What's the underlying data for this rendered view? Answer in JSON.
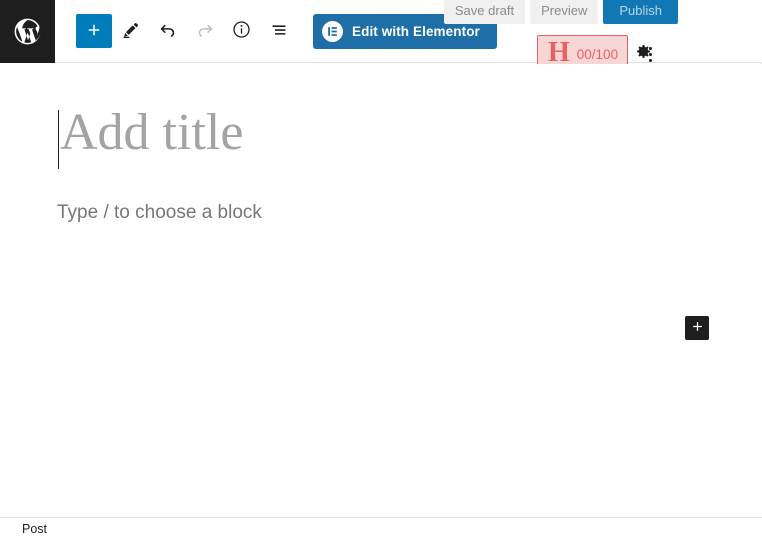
{
  "app": {
    "name": "WordPress Block Editor",
    "logo_icon": "wordpress-logo-icon"
  },
  "toolbar": {
    "add_block": {
      "label": "+",
      "icon": "plus-icon",
      "title": "Toggle block inserter",
      "color": "#007cba"
    },
    "tools": [
      {
        "name": "edit-mode-icon",
        "icon": "pencil-icon",
        "title": "Tools",
        "disabled": false
      },
      {
        "name": "undo-icon",
        "icon": "undo-arrow-icon",
        "title": "Undo",
        "disabled": false
      },
      {
        "name": "redo-icon",
        "icon": "redo-arrow-icon",
        "title": "Redo",
        "disabled": true
      },
      {
        "name": "details-icon",
        "icon": "info-circle-icon",
        "title": "Details",
        "disabled": false
      },
      {
        "name": "list-view-icon",
        "icon": "list-view-icon",
        "title": "List View",
        "disabled": false
      }
    ],
    "elementor": {
      "label": "Edit with Elementor",
      "icon": "elementor-logo-icon",
      "bg_color": "#1e6ea7",
      "text_color": "#ffffff"
    },
    "save_draft_label": "Save draft",
    "preview_label": "Preview",
    "publish_label": "Publish",
    "publish_color": "#1277b5",
    "settings_icon": "gear-icon",
    "settings_title": "Settings",
    "more_menu_icon": "kebab-menu-icon",
    "more_menu_title": "Options"
  },
  "seo_badge": {
    "letter": "H",
    "score": "00/100",
    "bg_color": "#f9d6d6",
    "border_color": "#e8605f",
    "text_color": "#e8605f",
    "title": "Headline Analyzer"
  },
  "canvas": {
    "title_placeholder": "Add title",
    "block_placeholder": "Type / to choose a block",
    "appender": {
      "label": "+",
      "icon": "plus-icon",
      "title": "Add block"
    }
  },
  "status_bar": {
    "breadcrumb": "Post"
  }
}
